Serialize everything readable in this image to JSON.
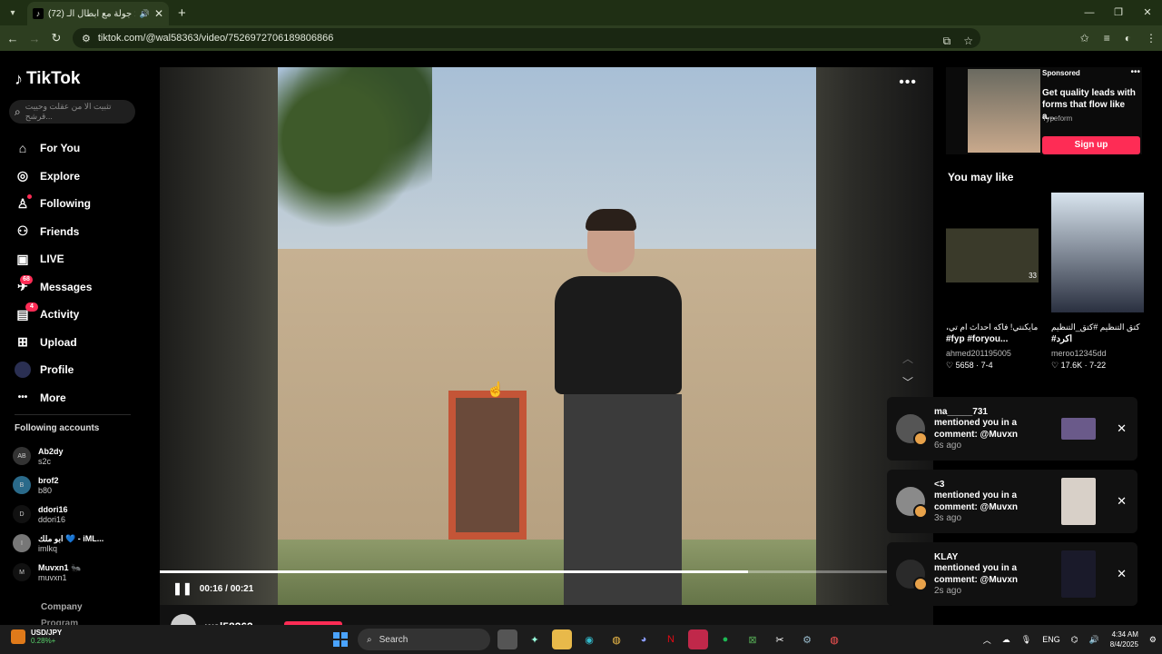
{
  "browser": {
    "tab_title": "(72) فرشح: جولة مع أبطال الـ...",
    "url": "tiktok.com/@wal58363/video/7526972706189806866",
    "window_controls": [
      "—",
      "❐",
      "✕"
    ]
  },
  "sidebar": {
    "logo": "TikTok",
    "search_placeholder": "تثبيت الا من عقلت وحييت قرشح...",
    "nav": [
      {
        "label": "For You",
        "icon": "home-icon",
        "glyph": "⌂"
      },
      {
        "label": "Explore",
        "icon": "compass-icon",
        "glyph": "◎"
      },
      {
        "label": "Following",
        "icon": "following-icon",
        "glyph": "♙"
      },
      {
        "label": "Friends",
        "icon": "friends-icon",
        "glyph": "⚇"
      },
      {
        "label": "LIVE",
        "icon": "live-icon",
        "glyph": "▣"
      },
      {
        "label": "Messages",
        "icon": "messages-icon",
        "glyph": "✈",
        "badge": "68"
      },
      {
        "label": "Activity",
        "icon": "activity-icon",
        "glyph": "▤",
        "badge": "4"
      },
      {
        "label": "Upload",
        "icon": "upload-icon",
        "glyph": "⊞"
      },
      {
        "label": "Profile",
        "icon": "profile-avatar"
      },
      {
        "label": "More",
        "icon": "more-icon",
        "glyph": "•••"
      }
    ],
    "following_header": "Following accounts",
    "accounts": [
      {
        "name": "Ab2dy",
        "sub": "s2c",
        "ava": "AB"
      },
      {
        "name": "brof2",
        "sub": "b80",
        "ava": "B"
      },
      {
        "name": "ddori16",
        "sub": "ddori16",
        "ava": "D"
      },
      {
        "name": "ابو ملك 💙 - iML...",
        "sub": "imlkq",
        "ava": "I"
      },
      {
        "name": "Muvxn1 🐜",
        "sub": "muvxn1",
        "ava": "M"
      }
    ],
    "company": "Company",
    "program": "Program"
  },
  "player": {
    "time": "00:16 / 00:21",
    "progress": 0.76,
    "author": "wal58363"
  },
  "ad": {
    "sponsored": "Sponsored",
    "title": "Get quality leads with forms that flow like a...",
    "brand": "Typeform",
    "cta": "Sign up"
  },
  "you_may_like": {
    "header": "You may like",
    "cards": [
      {
        "caption1": "،مايكنتي! فاكه احداث ام تي",
        "caption2": "#fyp #foryou...",
        "author": "ahmed201195005",
        "likes": "5658",
        "date": "7-4",
        "count": "33"
      },
      {
        "caption1": "كتق التنظيم #كتق_التنظيم",
        "caption2": "#اكرد",
        "author": "meroo12345dd",
        "likes": "17.6K",
        "date": "7-22"
      }
    ]
  },
  "notifications": [
    {
      "name": "ma_____731",
      "message": "mentioned you in a comment: @Muvxn",
      "time": "6s ago"
    },
    {
      "name": "<3",
      "message": "mentioned you in a comment: @Muvxn",
      "time": "3s ago"
    },
    {
      "name": "KLAY",
      "message": "mentioned you in a comment: @Muvxn",
      "time": "2s ago"
    }
  ],
  "taskbar": {
    "widget_name": "USD/JPY",
    "widget_value": "0.28%+",
    "search": "Search",
    "lang": "ENG",
    "time": "4:34 AM",
    "date": "8/4/2025"
  }
}
